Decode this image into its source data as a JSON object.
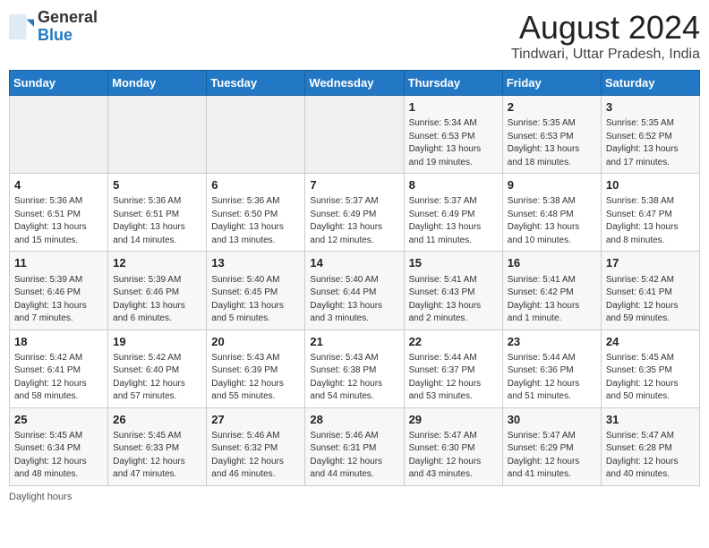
{
  "header": {
    "logo_general": "General",
    "logo_blue": "Blue",
    "main_title": "August 2024",
    "subtitle": "Tindwari, Uttar Pradesh, India"
  },
  "days_of_week": [
    "Sunday",
    "Monday",
    "Tuesday",
    "Wednesday",
    "Thursday",
    "Friday",
    "Saturday"
  ],
  "weeks": [
    [
      {
        "day": "",
        "info": ""
      },
      {
        "day": "",
        "info": ""
      },
      {
        "day": "",
        "info": ""
      },
      {
        "day": "",
        "info": ""
      },
      {
        "day": "1",
        "info": "Sunrise: 5:34 AM\nSunset: 6:53 PM\nDaylight: 13 hours\nand 19 minutes."
      },
      {
        "day": "2",
        "info": "Sunrise: 5:35 AM\nSunset: 6:53 PM\nDaylight: 13 hours\nand 18 minutes."
      },
      {
        "day": "3",
        "info": "Sunrise: 5:35 AM\nSunset: 6:52 PM\nDaylight: 13 hours\nand 17 minutes."
      }
    ],
    [
      {
        "day": "4",
        "info": "Sunrise: 5:36 AM\nSunset: 6:51 PM\nDaylight: 13 hours\nand 15 minutes."
      },
      {
        "day": "5",
        "info": "Sunrise: 5:36 AM\nSunset: 6:51 PM\nDaylight: 13 hours\nand 14 minutes."
      },
      {
        "day": "6",
        "info": "Sunrise: 5:36 AM\nSunset: 6:50 PM\nDaylight: 13 hours\nand 13 minutes."
      },
      {
        "day": "7",
        "info": "Sunrise: 5:37 AM\nSunset: 6:49 PM\nDaylight: 13 hours\nand 12 minutes."
      },
      {
        "day": "8",
        "info": "Sunrise: 5:37 AM\nSunset: 6:49 PM\nDaylight: 13 hours\nand 11 minutes."
      },
      {
        "day": "9",
        "info": "Sunrise: 5:38 AM\nSunset: 6:48 PM\nDaylight: 13 hours\nand 10 minutes."
      },
      {
        "day": "10",
        "info": "Sunrise: 5:38 AM\nSunset: 6:47 PM\nDaylight: 13 hours\nand 8 minutes."
      }
    ],
    [
      {
        "day": "11",
        "info": "Sunrise: 5:39 AM\nSunset: 6:46 PM\nDaylight: 13 hours\nand 7 minutes."
      },
      {
        "day": "12",
        "info": "Sunrise: 5:39 AM\nSunset: 6:46 PM\nDaylight: 13 hours\nand 6 minutes."
      },
      {
        "day": "13",
        "info": "Sunrise: 5:40 AM\nSunset: 6:45 PM\nDaylight: 13 hours\nand 5 minutes."
      },
      {
        "day": "14",
        "info": "Sunrise: 5:40 AM\nSunset: 6:44 PM\nDaylight: 13 hours\nand 3 minutes."
      },
      {
        "day": "15",
        "info": "Sunrise: 5:41 AM\nSunset: 6:43 PM\nDaylight: 13 hours\nand 2 minutes."
      },
      {
        "day": "16",
        "info": "Sunrise: 5:41 AM\nSunset: 6:42 PM\nDaylight: 13 hours\nand 1 minute."
      },
      {
        "day": "17",
        "info": "Sunrise: 5:42 AM\nSunset: 6:41 PM\nDaylight: 12 hours\nand 59 minutes."
      }
    ],
    [
      {
        "day": "18",
        "info": "Sunrise: 5:42 AM\nSunset: 6:41 PM\nDaylight: 12 hours\nand 58 minutes."
      },
      {
        "day": "19",
        "info": "Sunrise: 5:42 AM\nSunset: 6:40 PM\nDaylight: 12 hours\nand 57 minutes."
      },
      {
        "day": "20",
        "info": "Sunrise: 5:43 AM\nSunset: 6:39 PM\nDaylight: 12 hours\nand 55 minutes."
      },
      {
        "day": "21",
        "info": "Sunrise: 5:43 AM\nSunset: 6:38 PM\nDaylight: 12 hours\nand 54 minutes."
      },
      {
        "day": "22",
        "info": "Sunrise: 5:44 AM\nSunset: 6:37 PM\nDaylight: 12 hours\nand 53 minutes."
      },
      {
        "day": "23",
        "info": "Sunrise: 5:44 AM\nSunset: 6:36 PM\nDaylight: 12 hours\nand 51 minutes."
      },
      {
        "day": "24",
        "info": "Sunrise: 5:45 AM\nSunset: 6:35 PM\nDaylight: 12 hours\nand 50 minutes."
      }
    ],
    [
      {
        "day": "25",
        "info": "Sunrise: 5:45 AM\nSunset: 6:34 PM\nDaylight: 12 hours\nand 48 minutes."
      },
      {
        "day": "26",
        "info": "Sunrise: 5:45 AM\nSunset: 6:33 PM\nDaylight: 12 hours\nand 47 minutes."
      },
      {
        "day": "27",
        "info": "Sunrise: 5:46 AM\nSunset: 6:32 PM\nDaylight: 12 hours\nand 46 minutes."
      },
      {
        "day": "28",
        "info": "Sunrise: 5:46 AM\nSunset: 6:31 PM\nDaylight: 12 hours\nand 44 minutes."
      },
      {
        "day": "29",
        "info": "Sunrise: 5:47 AM\nSunset: 6:30 PM\nDaylight: 12 hours\nand 43 minutes."
      },
      {
        "day": "30",
        "info": "Sunrise: 5:47 AM\nSunset: 6:29 PM\nDaylight: 12 hours\nand 41 minutes."
      },
      {
        "day": "31",
        "info": "Sunrise: 5:47 AM\nSunset: 6:28 PM\nDaylight: 12 hours\nand 40 minutes."
      }
    ]
  ],
  "footer": {
    "daylight_label": "Daylight hours"
  }
}
